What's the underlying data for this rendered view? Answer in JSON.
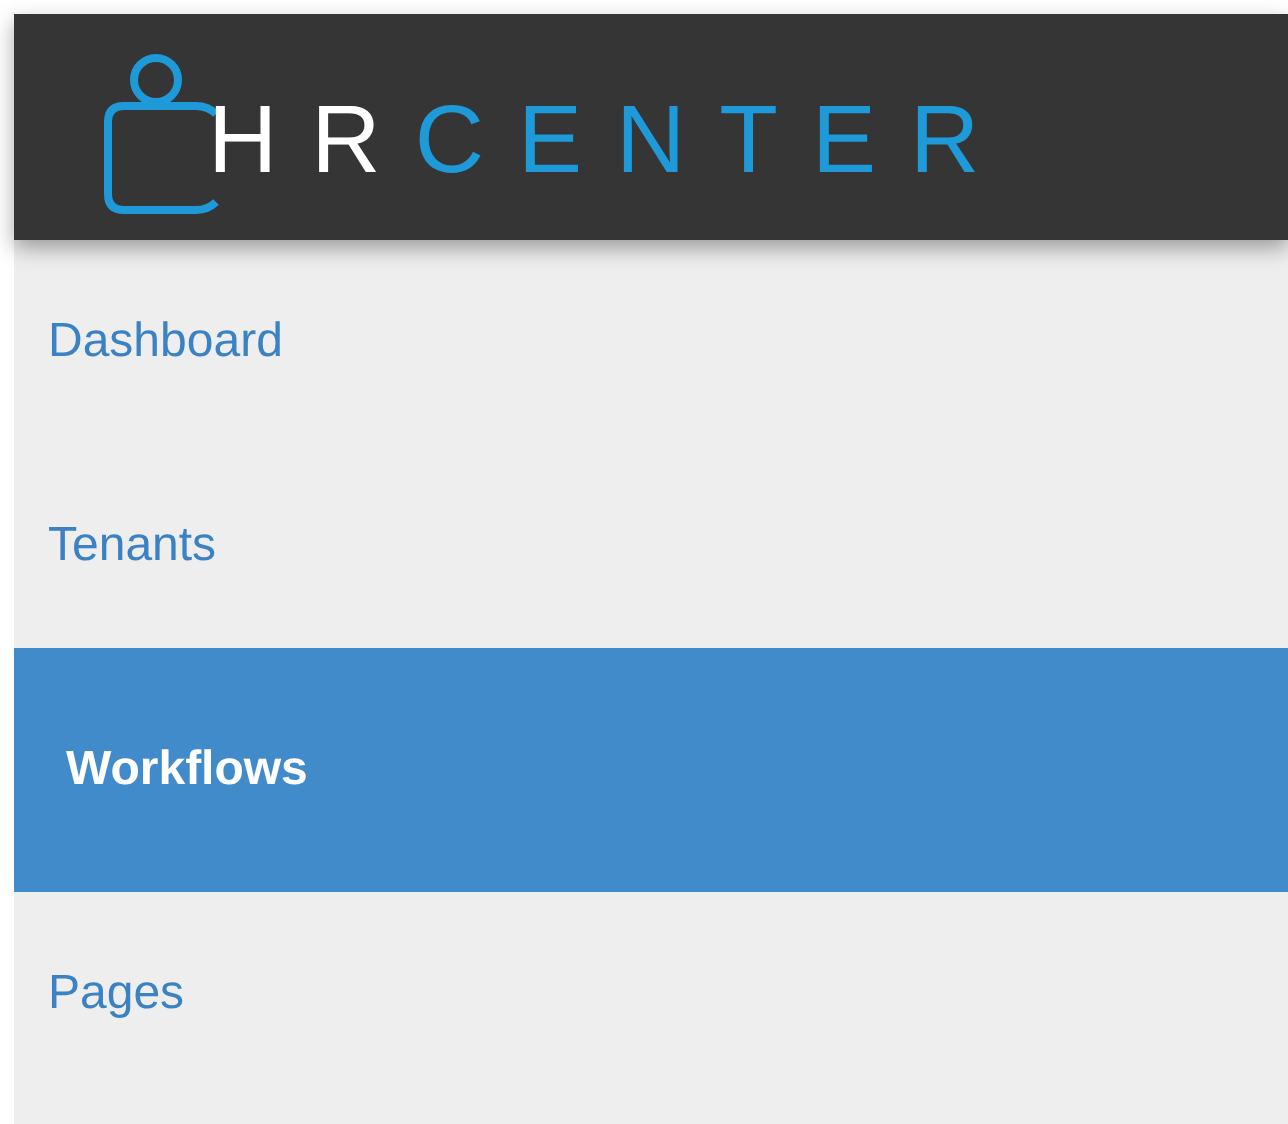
{
  "header": {
    "logo": {
      "first_part": "HR",
      "second_part": "CENTER"
    }
  },
  "sidebar": {
    "items": [
      {
        "label": "Dashboard",
        "selected": false
      },
      {
        "label": "Tenants",
        "selected": false
      },
      {
        "label": "Workflows",
        "selected": true
      },
      {
        "label": "Pages",
        "selected": false
      }
    ]
  }
}
